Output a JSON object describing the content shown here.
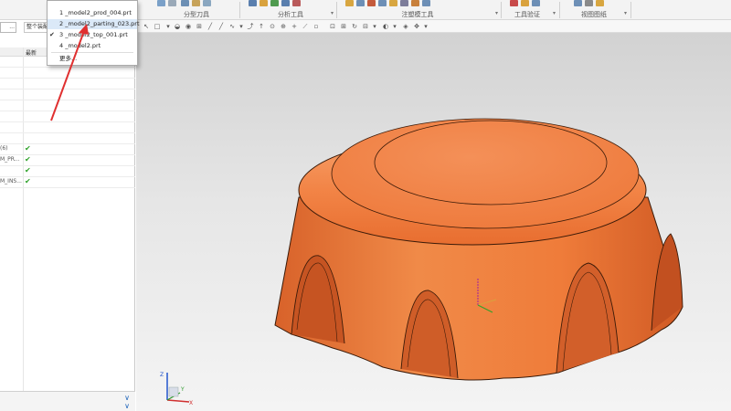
{
  "ribbon": {
    "groups": [
      {
        "label": "分型刀具"
      },
      {
        "label": "分析工具"
      },
      {
        "label": "注塑模工具"
      },
      {
        "label": "工具验证"
      },
      {
        "label": "视图图纸"
      }
    ]
  },
  "recent_files": {
    "items": [
      {
        "label": "1 _model2_prod_004.prt",
        "checked": false,
        "highlighted": false
      },
      {
        "label": "2 _model2_parting_023.prt",
        "checked": false,
        "highlighted": true
      },
      {
        "label": "3 _model2_top_001.prt",
        "checked": true,
        "highlighted": false
      },
      {
        "label": "4 _model2.prt",
        "checked": false,
        "highlighted": false
      }
    ],
    "more_label": "更多..."
  },
  "left_panel": {
    "filter_select": "...",
    "filter_text": "整个装配",
    "column_latest": "最新",
    "rows": [
      {
        "name": "",
        "check": false
      },
      {
        "name": "",
        "check": false
      },
      {
        "name": "",
        "check": false
      },
      {
        "name": "",
        "check": false
      },
      {
        "name": "",
        "check": false
      },
      {
        "name": "",
        "check": false
      },
      {
        "name": "",
        "check": false
      },
      {
        "name": "",
        "check": false
      },
      {
        "name": "(6)",
        "check": true
      },
      {
        "name": "M_PR...",
        "check": true
      },
      {
        "name": "",
        "check": true
      },
      {
        "name": "M_INS...",
        "check": true
      }
    ],
    "bottom_chevron_1": "∨",
    "bottom_chevron_2": "∨"
  },
  "colors": {
    "model_fill": "#f07a3a",
    "model_edge": "#3a1a08",
    "check_green": "#2fa22a",
    "highlight": "#dbe9f8",
    "annotation_red": "#e03030"
  },
  "triad": {
    "x": "X",
    "y": "Y",
    "z": "Z"
  }
}
